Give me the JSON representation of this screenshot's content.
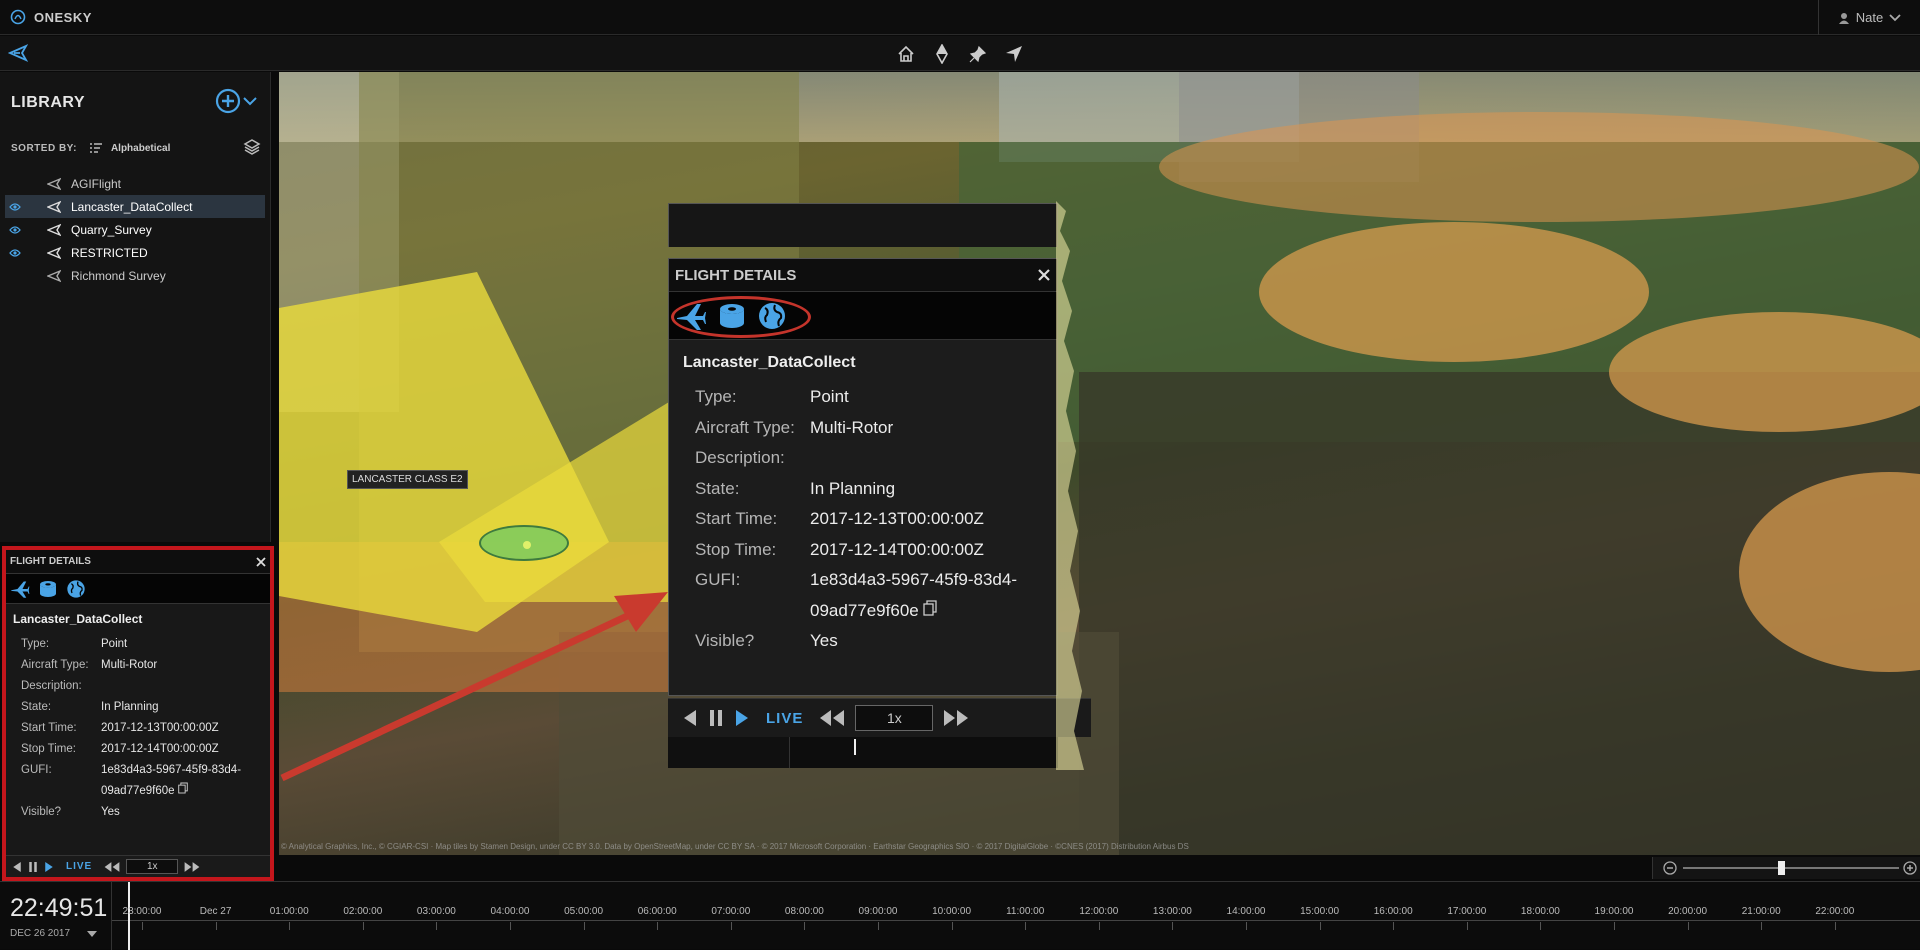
{
  "app": {
    "title": "ONESKY",
    "user": "Nate"
  },
  "library": {
    "title": "LIBRARY",
    "sorted_by_label": "SORTED BY:",
    "sort_value": "Alphabetical",
    "items": [
      {
        "name": "AGIFlight",
        "visible": false,
        "selected": false
      },
      {
        "name": "Lancaster_DataCollect",
        "visible": true,
        "selected": true
      },
      {
        "name": "Quarry_Survey",
        "visible": true,
        "selected": false
      },
      {
        "name": "RESTRICTED",
        "visible": true,
        "selected": false
      },
      {
        "name": "Richmond Survey",
        "visible": false,
        "selected": false
      }
    ]
  },
  "map": {
    "label": "LANCASTER CLASS E2",
    "credits": "© Analytical Graphics, Inc., © CGIAR-CSI · Map tiles by Stamen Design, under CC BY 3.0. Data by OpenStreetMap, under CC BY SA · © 2017 Microsoft Corporation · Earthstar Geographics SIO · © 2017 DigitalGlobe · ©CNES (2017) Distribution Airbus DS"
  },
  "flight_details": {
    "title": "FLIGHT DETAILS",
    "name": "Lancaster_DataCollect",
    "fields": [
      {
        "key": "Type:",
        "value": "Point"
      },
      {
        "key": "Aircraft Type:",
        "value": "Multi-Rotor"
      },
      {
        "key": "Description:",
        "value": ""
      },
      {
        "key": "State:",
        "value": "In Planning"
      },
      {
        "key": "Start Time:",
        "value": "2017-12-13T00:00:00Z"
      },
      {
        "key": "Stop Time:",
        "value": "2017-12-14T00:00:00Z"
      },
      {
        "key": "GUFI:",
        "value": "1e83d4a3-5967-45f9-83d4-09ad77e9f60e"
      },
      {
        "key": "Visible?",
        "value": "Yes"
      }
    ]
  },
  "playback": {
    "live_label": "LIVE",
    "speed": "1x"
  },
  "timeline": {
    "time": "22:49:51",
    "date": "DEC 26 2017",
    "ticks": [
      "23:00:00",
      "Dec 27",
      "01:00:00",
      "02:00:00",
      "03:00:00",
      "04:00:00",
      "05:00:00",
      "06:00:00",
      "07:00:00",
      "08:00:00",
      "09:00:00",
      "10:00:00",
      "11:00:00",
      "12:00:00",
      "13:00:00",
      "14:00:00",
      "15:00:00",
      "16:00:00",
      "17:00:00",
      "18:00:00",
      "19:00:00",
      "20:00:00",
      "21:00:00",
      "22:00:00"
    ]
  },
  "colors": {
    "accent": "#4aa4e6",
    "highlight": "#c4161c"
  }
}
